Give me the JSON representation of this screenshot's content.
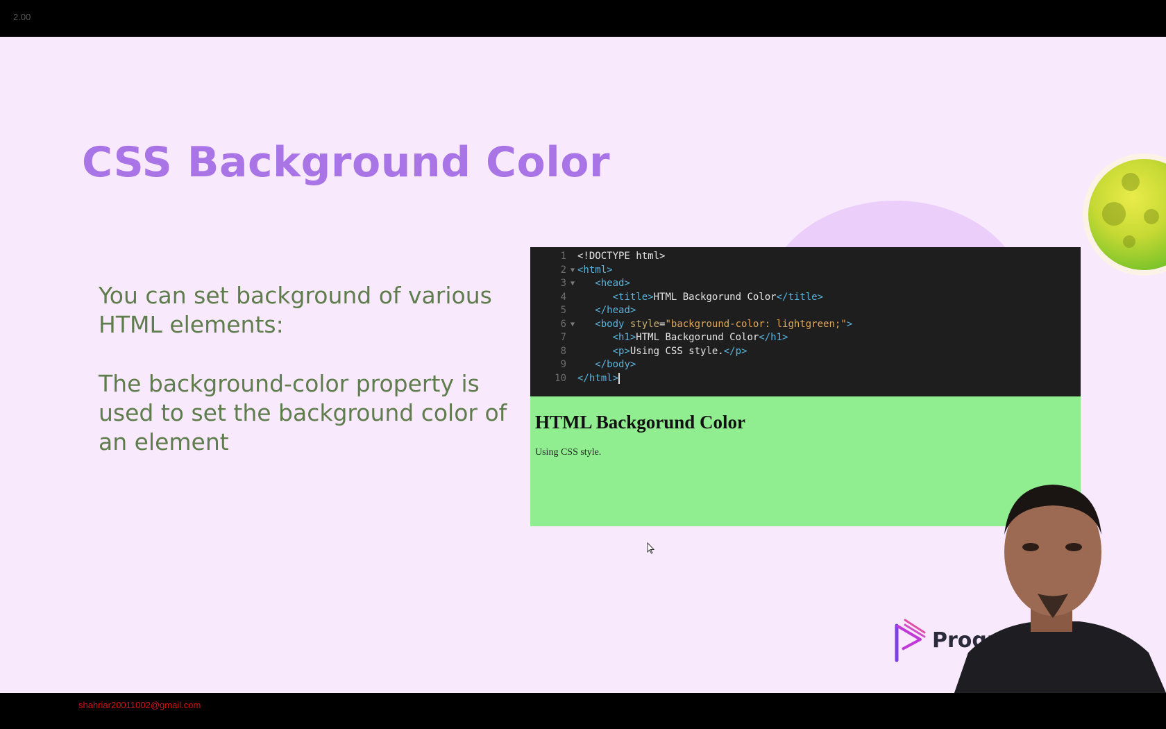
{
  "player": {
    "speed_label": "2.00"
  },
  "slide": {
    "title": "CSS Background Color",
    "paragraphs": [
      "You can set background of various HTML elements:",
      "The background-color property is used to set the background color of an element"
    ],
    "colors": {
      "title": "#a874e6",
      "body_text": "#5f7d4c",
      "slide_bg": "#f8e9fd",
      "preview_bg": "#90ee90"
    },
    "code_editor": {
      "lines": [
        {
          "n": "1",
          "fold": "",
          "parts": [
            [
              "plain",
              "<!DOCTYPE html>"
            ]
          ]
        },
        {
          "n": "2",
          "fold": "▼",
          "parts": [
            [
              "tag",
              "<html>"
            ]
          ]
        },
        {
          "n": "3",
          "fold": "▼",
          "parts": [
            [
              "plain",
              "   "
            ],
            [
              "tag",
              "<head>"
            ]
          ]
        },
        {
          "n": "4",
          "fold": "",
          "parts": [
            [
              "plain",
              "      "
            ],
            [
              "tag",
              "<title>"
            ],
            [
              "plain",
              "HTML Backgorund Color"
            ],
            [
              "tag",
              "</title>"
            ]
          ]
        },
        {
          "n": "5",
          "fold": "",
          "parts": [
            [
              "plain",
              "   "
            ],
            [
              "tag",
              "</head>"
            ]
          ]
        },
        {
          "n": "6",
          "fold": "▼",
          "parts": [
            [
              "plain",
              "   "
            ],
            [
              "tag",
              "<body "
            ],
            [
              "attr",
              "style"
            ],
            [
              "plain",
              "="
            ],
            [
              "str",
              "\"background-color: lightgreen;\""
            ],
            [
              "tag",
              ">"
            ]
          ]
        },
        {
          "n": "7",
          "fold": "",
          "parts": [
            [
              "plain",
              "      "
            ],
            [
              "tag",
              "<h1>"
            ],
            [
              "plain",
              "HTML Backgorund Color"
            ],
            [
              "tag",
              "</h1>"
            ]
          ]
        },
        {
          "n": "8",
          "fold": "",
          "parts": [
            [
              "plain",
              "      "
            ],
            [
              "tag",
              "<p>"
            ],
            [
              "plain",
              "Using CSS style."
            ],
            [
              "tag",
              "</p>"
            ]
          ]
        },
        {
          "n": "9",
          "fold": "",
          "parts": [
            [
              "plain",
              "   "
            ],
            [
              "tag",
              "</body>"
            ]
          ]
        },
        {
          "n": "10",
          "fold": "",
          "parts": [
            [
              "tag",
              "</html>"
            ]
          ]
        }
      ]
    },
    "preview": {
      "heading": "HTML Backgorund Color",
      "paragraph": "Using CSS style."
    },
    "logo": {
      "text": "Progran"
    }
  },
  "footer": {
    "email": "shahriar20011002@gmail.com"
  }
}
